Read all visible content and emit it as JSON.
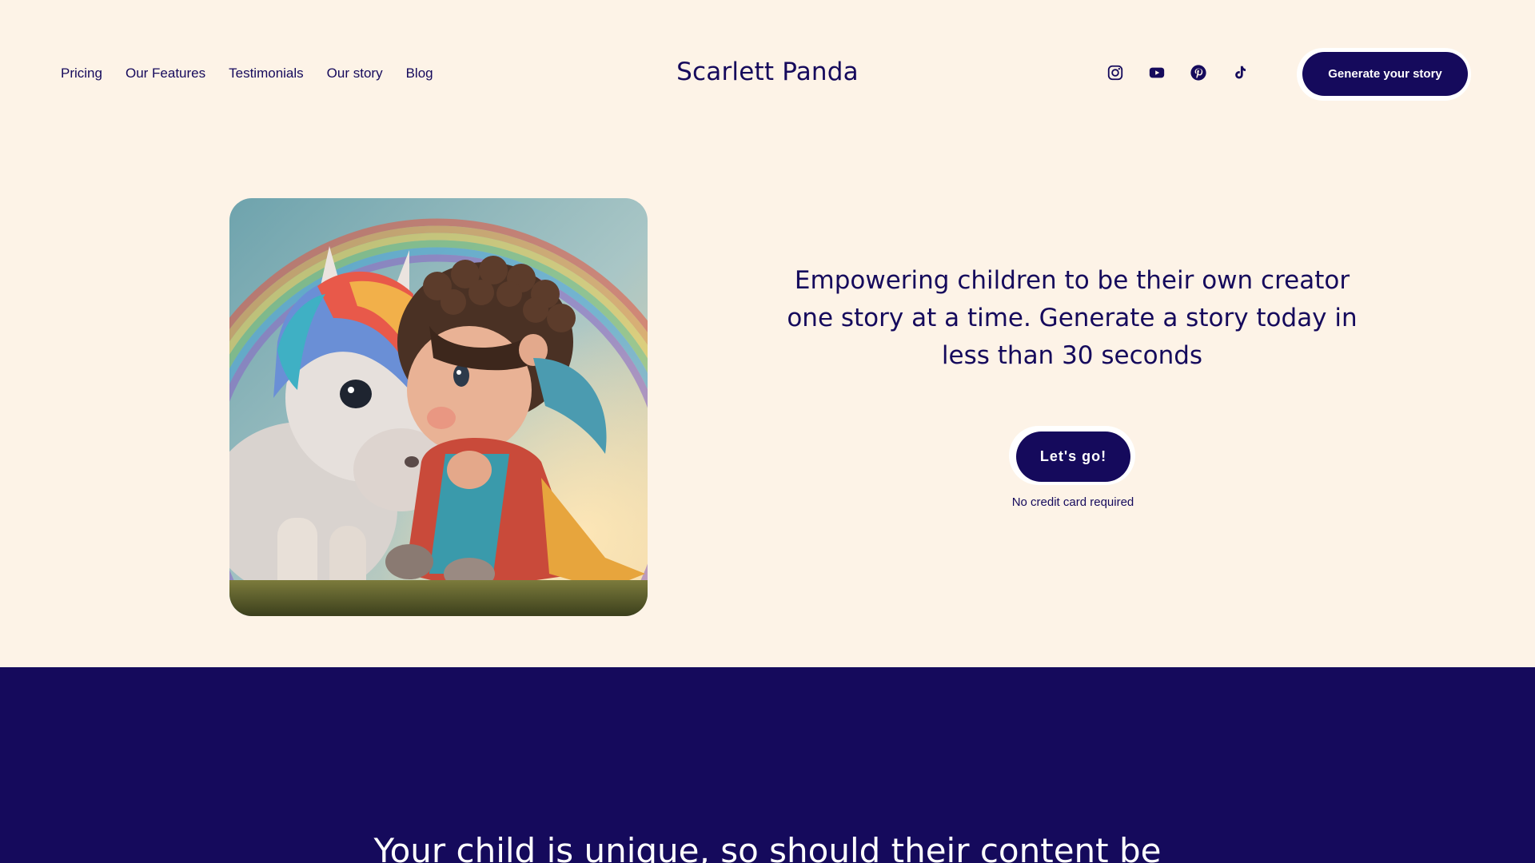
{
  "nav": {
    "items": [
      {
        "label": "Pricing"
      },
      {
        "label": "Our Features"
      },
      {
        "label": "Testimonials"
      },
      {
        "label": "Our story"
      },
      {
        "label": "Blog"
      }
    ]
  },
  "brand": {
    "name": "Scarlett Panda"
  },
  "socials": {
    "icons": [
      "instagram-icon",
      "youtube-icon",
      "pinterest-icon",
      "tiktok-icon"
    ]
  },
  "header_cta": {
    "label": "Generate your story"
  },
  "hero": {
    "headline_lines": [
      "Empowering children to be their own creator",
      "one story at a time. Generate a story today in",
      "less than 30 seconds"
    ],
    "cta_label": "Let's go!",
    "subnote": "No credit card required"
  },
  "band": {
    "title": "Your child is unique, so should their content be"
  },
  "colors": {
    "background": "#fdf3e7",
    "primary": "#150a5c",
    "button_text": "#ffffff"
  }
}
